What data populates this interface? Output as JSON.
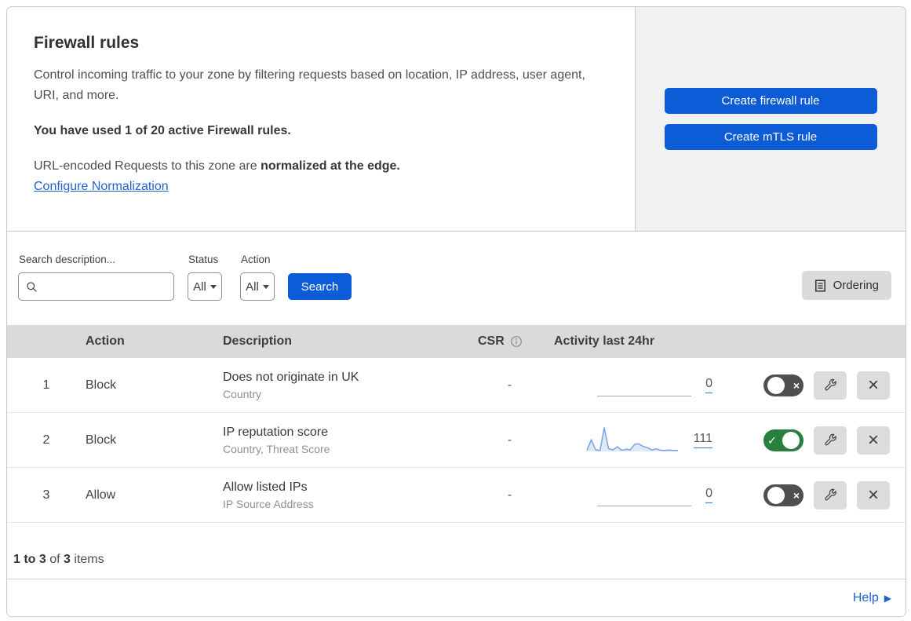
{
  "header": {
    "title": "Firewall rules",
    "description": "Control incoming traffic to your zone by filtering requests based on location, IP address, user agent, URI, and more.",
    "usage": "You have used 1 of 20 active Firewall rules.",
    "normalization_prefix": "URL-encoded Requests to this zone are ",
    "normalization_bold": "normalized at the edge.",
    "normalization_link": "Configure Normalization",
    "create_firewall_label": "Create firewall rule",
    "create_mtls_label": "Create mTLS rule"
  },
  "filters": {
    "search_label": "Search description...",
    "search_value": "",
    "status_label": "Status",
    "status_value": "All",
    "action_label": "Action",
    "action_value": "All",
    "search_button_label": "Search",
    "ordering_button_label": "Ordering"
  },
  "table": {
    "columns": {
      "action": "Action",
      "description": "Description",
      "csr": "CSR",
      "activity": "Activity last 24hr"
    },
    "rows": [
      {
        "index": "1",
        "action": "Block",
        "description": "Does not originate in UK",
        "criteria": "Country",
        "csr": "-",
        "activity_count": "0",
        "enabled": false,
        "sparkline": null
      },
      {
        "index": "2",
        "action": "Block",
        "description": "IP reputation score",
        "criteria": "Country, Threat Score",
        "csr": "-",
        "activity_count": "111",
        "enabled": true,
        "sparkline": [
          5,
          50,
          7,
          4,
          100,
          12,
          6,
          20,
          5,
          9,
          7,
          30,
          32,
          21,
          16,
          6,
          11,
          5,
          4,
          6,
          4,
          4
        ]
      },
      {
        "index": "3",
        "action": "Allow",
        "description": "Allow listed IPs",
        "criteria": "IP Source Address",
        "csr": "-",
        "activity_count": "0",
        "enabled": false,
        "sparkline": null
      }
    ],
    "footer": {
      "range": "1 to 3",
      "of": " of ",
      "total": "3",
      "items": " items"
    }
  },
  "help": {
    "label": "Help",
    "chevron": "▶"
  },
  "icons": {
    "toggle_on": "✓",
    "toggle_off": "×",
    "delete": "×"
  },
  "colors": {
    "primary_blue": "#0b5cd6",
    "link_blue": "#2264cb",
    "toggle_on_green": "#297f3e",
    "toggle_off_gray": "#4f4f4f",
    "sparkline_blue": "#76a3e8",
    "header_band_gray": "#dadada",
    "side_panel_gray": "#f1f1f1"
  }
}
